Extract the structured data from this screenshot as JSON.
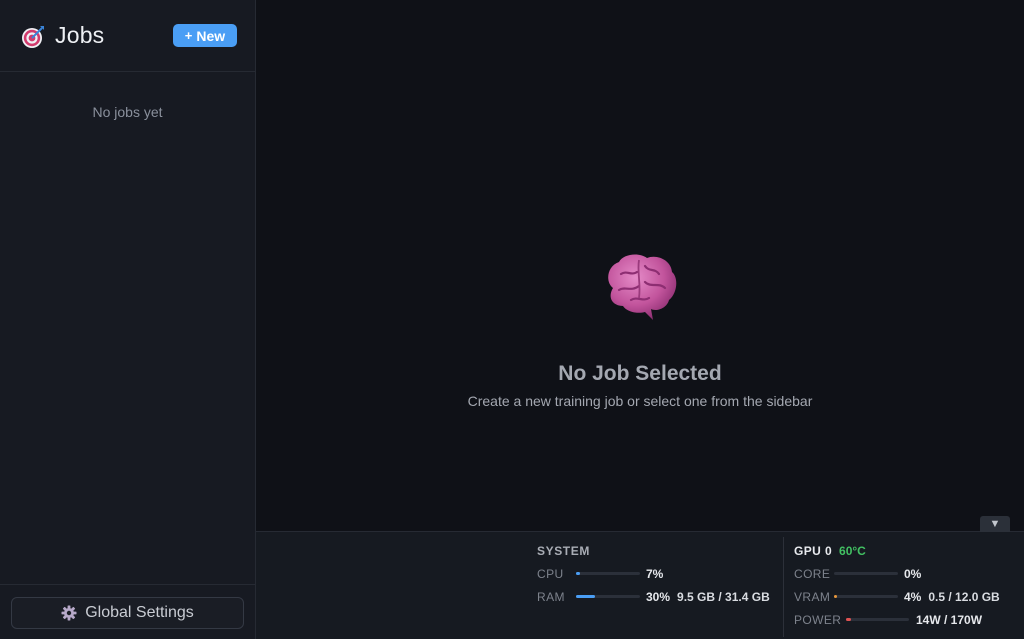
{
  "sidebar": {
    "title": "Jobs",
    "new_button": "New",
    "new_button_prefix": "+",
    "empty_text": "No jobs yet",
    "settings_label": "Global Settings"
  },
  "main": {
    "empty_title": "No Job Selected",
    "empty_subtitle": "Create a new training job or select one from the sidebar"
  },
  "stats": {
    "system": {
      "title": "SYSTEM",
      "cpu": {
        "label": "CPU",
        "value": "7%",
        "fraction": 0.07
      },
      "ram": {
        "label": "RAM",
        "value": "30%",
        "fraction": 0.3,
        "detail": "9.5 GB / 31.4 GB"
      }
    },
    "gpu": {
      "name": "GPU 0",
      "temp": "60°C",
      "core": {
        "label": "CORE",
        "value": "0%",
        "fraction": 0.0
      },
      "vram": {
        "label": "VRAM",
        "value": "4%",
        "fraction": 0.04,
        "detail": "0.5 / 12.0 GB"
      },
      "power": {
        "label": "POWER",
        "value": "14W / 170W",
        "fraction": 0.08
      }
    }
  },
  "colors": {
    "accent": "#4a9ef5",
    "cpu_bar": "#4a9ef5",
    "ram_bar": "#4a9ef5",
    "vram_bar": "#e8973b",
    "power_bar": "#e05252",
    "temp": "#42c163"
  },
  "icons": {
    "logo": "target-icon",
    "settings": "gear-icon",
    "empty_state": "brain-icon",
    "collapse": "chevron-down-icon"
  }
}
